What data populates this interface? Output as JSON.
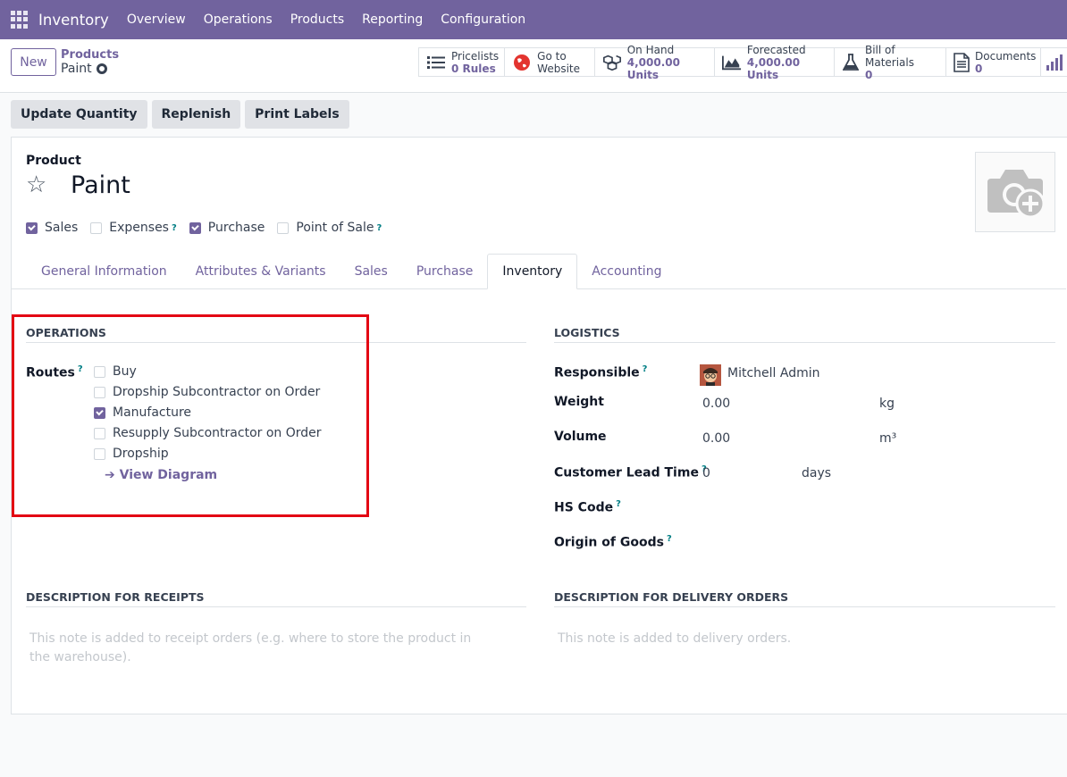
{
  "topbar": {
    "app": "Inventory",
    "menus": [
      "Overview",
      "Operations",
      "Products",
      "Reporting",
      "Configuration"
    ]
  },
  "control": {
    "new_label": "New",
    "breadcrumb_parent": "Products",
    "breadcrumb_current": "Paint"
  },
  "stats": [
    {
      "icon": "list-icon",
      "l1": "Pricelists",
      "l2": "0 Rules"
    },
    {
      "icon": "globe-icon",
      "l1": "Go to",
      "l2": "Website"
    },
    {
      "icon": "cubes-icon",
      "l1": "On Hand",
      "l2": "4,000.00 Units"
    },
    {
      "icon": "area-chart-icon",
      "l1": "Forecasted",
      "l2": "4,000.00 Units"
    },
    {
      "icon": "flask-icon",
      "l1": "Bill of Materials",
      "l2": "0"
    },
    {
      "icon": "document-icon",
      "l1": "Documents",
      "l2": "0"
    }
  ],
  "actions": [
    "Update Quantity",
    "Replenish",
    "Print Labels"
  ],
  "product": {
    "label": "Product",
    "name": "Paint"
  },
  "checks": [
    {
      "label": "Sales",
      "on": true,
      "help": false
    },
    {
      "label": "Expenses",
      "on": false,
      "help": true
    },
    {
      "label": "Purchase",
      "on": true,
      "help": false
    },
    {
      "label": "Point of Sale",
      "on": false,
      "help": true
    }
  ],
  "tabs": [
    "General Information",
    "Attributes & Variants",
    "Sales",
    "Purchase",
    "Inventory",
    "Accounting"
  ],
  "operations": {
    "title": "OPERATIONS",
    "routes_label": "Routes",
    "routes": [
      {
        "label": "Buy",
        "on": false
      },
      {
        "label": "Dropship Subcontractor on Order",
        "on": false
      },
      {
        "label": "Manufacture",
        "on": true
      },
      {
        "label": "Resupply Subcontractor on Order",
        "on": false
      },
      {
        "label": "Dropship",
        "on": false
      }
    ],
    "view_diagram": "View Diagram"
  },
  "logistics": {
    "title": "LOGISTICS",
    "responsible_label": "Responsible",
    "responsible": "Mitchell Admin",
    "weight_label": "Weight",
    "weight": "0.00",
    "weight_unit": "kg",
    "volume_label": "Volume",
    "volume": "0.00",
    "volume_unit": "m³",
    "lead_label": "Customer Lead Time",
    "lead": "0",
    "lead_unit": "days",
    "hs_label": "HS Code",
    "origin_label": "Origin of Goods"
  },
  "desc": {
    "receipts_title": "DESCRIPTION FOR RECEIPTS",
    "receipts_ph": "This note is added to receipt orders (e.g. where to store the product in the warehouse).",
    "delivery_title": "DESCRIPTION FOR DELIVERY ORDERS",
    "delivery_ph": "This note is added to delivery orders."
  },
  "colors": {
    "brand": "#71639e",
    "highlight": "#e30613"
  }
}
